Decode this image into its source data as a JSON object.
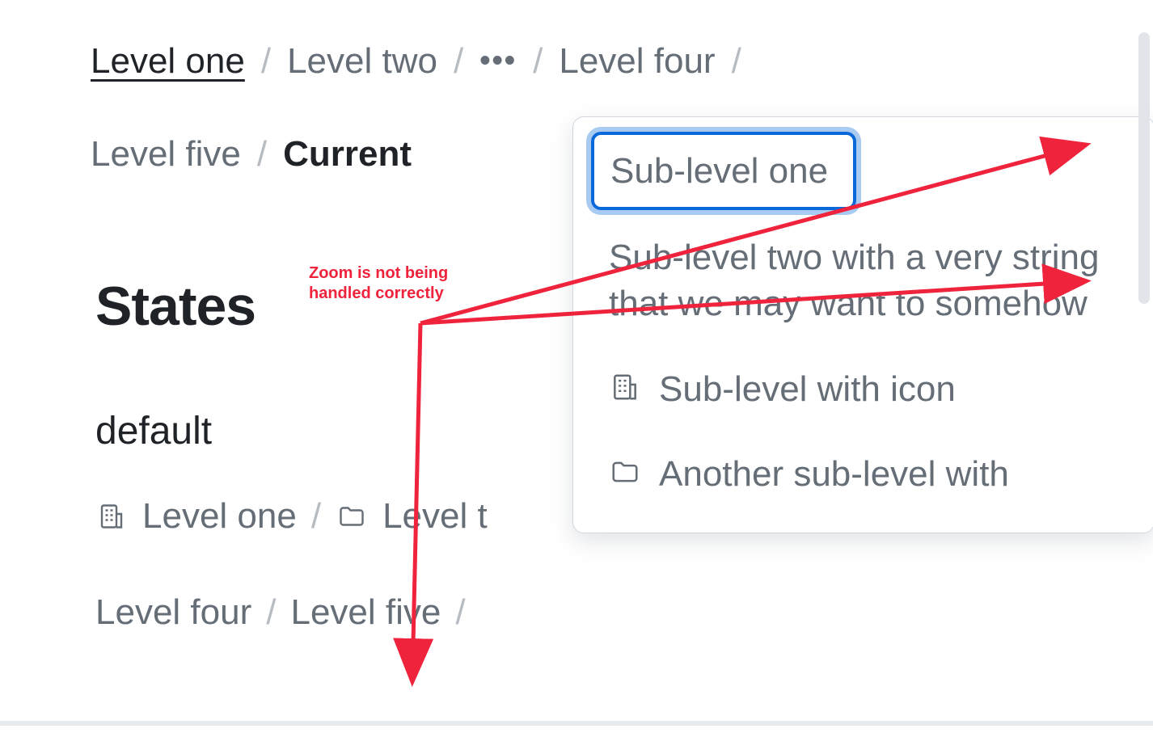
{
  "breadcrumb_top": {
    "items": [
      {
        "label": "Level one",
        "state": "hovered"
      },
      {
        "label": "Level two"
      },
      {
        "label": "Level four"
      },
      {
        "label": "Level five"
      }
    ],
    "ellipsis": "•••",
    "separator": "/",
    "current": "Current"
  },
  "states": {
    "heading": "States",
    "variant": "default",
    "breadcrumb": {
      "items": [
        {
          "label": "Level one",
          "icon": "building-icon"
        },
        {
          "label": "Level two",
          "icon": "folder-icon",
          "truncated": true
        },
        {
          "label": "Level four"
        },
        {
          "label": "Level five"
        }
      ],
      "separator": "/"
    }
  },
  "dropdown": {
    "items": [
      {
        "label": "Sub-level one",
        "focused": true
      },
      {
        "label": "Sub-level two with a very string that we may want to somehow",
        "truncated": true
      },
      {
        "label": "Sub-level with icon",
        "icon": "building-icon"
      },
      {
        "label": "Another sub-level with",
        "icon": "folder-icon",
        "truncated": true
      }
    ]
  },
  "annotation": {
    "text": "Zoom is not being\nhandled correctly",
    "color": "#ef233c"
  }
}
